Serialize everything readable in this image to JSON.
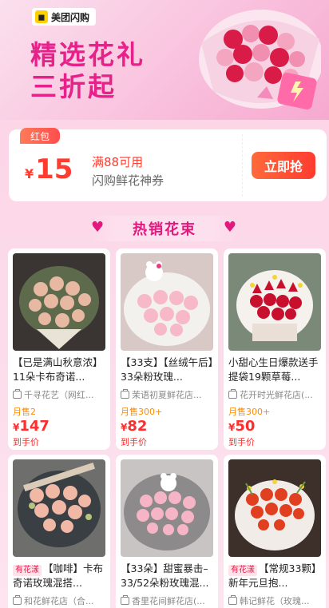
{
  "banner": {
    "brand": "美团闪购",
    "brand_icon": "meituan-bag-icon",
    "headline_line1": "精选花礼",
    "headline_line2": "三折起"
  },
  "coupon": {
    "tag": "红包",
    "currency": "¥",
    "amount": "15",
    "condition": "满88可用",
    "description": "闪购鲜花神券",
    "button": "立即抢"
  },
  "section": {
    "title": "热销花束"
  },
  "products": [
    {
      "tag": "",
      "title": "【已是满山秋意浓】11朵卡布奇诺...",
      "shop": "千寻花艺（网红...",
      "sold": "月售2",
      "currency": "¥",
      "price": "147",
      "price_note": "到手价"
    },
    {
      "tag": "",
      "title": "【33支】【丝绒午后】33朵粉玫瑰...",
      "shop": "茉语初夏鲜花店...",
      "sold": "月售300+",
      "currency": "¥",
      "price": "82",
      "price_note": "到手价"
    },
    {
      "tag": "",
      "title": "小甜心生日爆款送手提袋19颗草莓...",
      "shop": "花开时光鲜花店(...",
      "sold": "月售300+",
      "currency": "¥",
      "price": "50",
      "price_note": "到手价"
    },
    {
      "tag": "有花漾",
      "title": "【咖啡】卡布奇诺玫瑰混搭...",
      "shop": "和花鲜花店（合...",
      "sold": "",
      "currency": "",
      "price": "",
      "price_note": ""
    },
    {
      "tag": "",
      "title": "【33朵】甜蜜暴击–33/52朵粉玫瑰混...",
      "shop": "香里花间鲜花店(...",
      "sold": "",
      "currency": "",
      "price": "",
      "price_note": ""
    },
    {
      "tag": "有花漾",
      "title": "【常规33颗】新年元旦抱...",
      "shop": "韩记鲜花（玫瑰...",
      "sold": "",
      "currency": "",
      "price": "",
      "price_note": ""
    }
  ],
  "colors": {
    "accent": "#e8218a",
    "price": "#ff2d2d",
    "sold": "#ff8a00",
    "button": "#ff3b30"
  }
}
